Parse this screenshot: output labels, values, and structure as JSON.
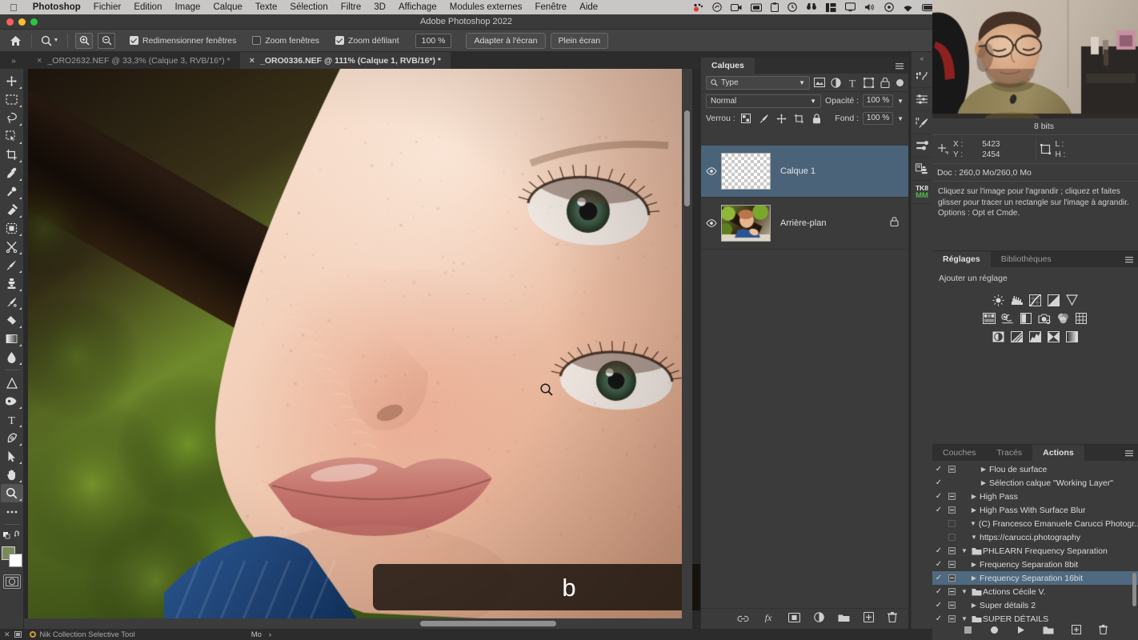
{
  "macmenu": {
    "apple": "",
    "items": [
      {
        "label": "Photoshop",
        "bold": true
      },
      {
        "label": "Fichier",
        "bold": false
      },
      {
        "label": "Edition",
        "bold": false
      },
      {
        "label": "Image",
        "bold": false
      },
      {
        "label": "Calque",
        "bold": false
      },
      {
        "label": "Texte",
        "bold": false
      },
      {
        "label": "Sélection",
        "bold": false
      },
      {
        "label": "Filtre",
        "bold": false
      },
      {
        "label": "3D",
        "bold": false
      },
      {
        "label": "Affichage",
        "bold": false
      },
      {
        "label": "Modules externes",
        "bold": false
      },
      {
        "label": "Fenêtre",
        "bold": false
      },
      {
        "label": "Aide",
        "bold": false
      }
    ],
    "tray_icons": [
      "record-icon",
      "creative-cloud-icon",
      "screen-record-icon",
      "display-icon",
      "clipboard-icon",
      "time-machine-icon",
      "binoculars-icon",
      "grid-icon",
      "monitor-icon",
      "volume-icon",
      "control-center-icon",
      "wifi-icon",
      "battery-icon"
    ]
  },
  "window": {
    "title": "Adobe Photoshop 2022"
  },
  "options_bar": {
    "home_icon": "home-icon",
    "tool_icon": "zoom-tool-icon",
    "zoom_in_label": "zoom-in-icon",
    "zoom_out_label": "zoom-out-icon",
    "checkboxes": [
      {
        "label": "Redimensionner fenêtres",
        "checked": true
      },
      {
        "label": "Zoom fenêtres",
        "checked": false
      },
      {
        "label": "Zoom défilant",
        "checked": true
      }
    ],
    "zoom_value": "100 %",
    "fit_screen": "Adapter à l'écran",
    "full_screen": "Plein écran"
  },
  "tabs": {
    "expander": "»",
    "items": [
      {
        "label": "_ORO2632.NEF @ 33,3% (Calque 3, RVB/16*) *",
        "active": false
      },
      {
        "label": "_ORO0336.NEF @ 111% (Calque 1, RVB/16*) *",
        "active": true
      }
    ]
  },
  "toolbar": {
    "tools": [
      {
        "name": "move-tool",
        "icon": "move"
      },
      {
        "name": "marquee-tool",
        "icon": "marquee"
      },
      {
        "name": "lasso-tool",
        "icon": "lasso"
      },
      {
        "name": "quick-selection-tool",
        "icon": "quickselect"
      },
      {
        "name": "crop-tool",
        "icon": "crop"
      },
      {
        "name": "eyedropper-tool",
        "icon": "eyedropper"
      },
      {
        "name": "spot-healing-brush-tool",
        "icon": "healing"
      },
      {
        "name": "patch-tool",
        "icon": "patch"
      },
      {
        "name": "frame-tool",
        "icon": "frame"
      },
      {
        "name": "scissors-tool",
        "icon": "scissors"
      },
      {
        "name": "brush-tool",
        "icon": "brush"
      },
      {
        "name": "clone-stamp-tool",
        "icon": "stamp"
      },
      {
        "name": "history-brush-tool",
        "icon": "historybrush"
      },
      {
        "name": "eraser-tool",
        "icon": "eraser"
      },
      {
        "name": "gradient-tool",
        "icon": "gradient"
      },
      {
        "name": "blur-tool",
        "icon": "blur"
      },
      {
        "name": "dodge-tool",
        "icon": "dodge"
      },
      {
        "name": "pen-tool",
        "icon": "penblob"
      },
      {
        "name": "type-tool",
        "icon": "type"
      },
      {
        "name": "path-tool",
        "icon": "path"
      },
      {
        "name": "path-selection-tool",
        "icon": "arrow"
      },
      {
        "name": "hand-tool",
        "icon": "hand"
      },
      {
        "name": "zoom-tool",
        "icon": "zoom",
        "selected": true
      },
      {
        "name": "more-tools",
        "icon": "ellipsis"
      }
    ],
    "foreground_color": "#7a8a5a",
    "background_color": "#ffffff"
  },
  "canvas": {
    "key_overlay": "b",
    "cursor": "zoom-cursor"
  },
  "layers_panel": {
    "tab_title": "Calques",
    "filter_label": "Type",
    "filter_icons": [
      "pixel-filter-icon",
      "adjustment-filter-icon",
      "type-filter-icon",
      "shape-filter-icon",
      "smartobject-filter-icon"
    ],
    "blend_mode": "Normal",
    "opacity_label": "Opacité :",
    "opacity_value": "100 %",
    "lock_label": "Verrou :",
    "lock_icons": [
      "lock-transparency-icon",
      "lock-image-icon",
      "lock-position-icon",
      "lock-artboard-icon",
      "lock-all-icon"
    ],
    "fill_label": "Fond :",
    "fill_value": "100 %",
    "layers": [
      {
        "name": "Calque 1",
        "visible": true,
        "selected": true,
        "thumb": "transparent",
        "locked": false
      },
      {
        "name": "Arrière-plan",
        "visible": true,
        "selected": false,
        "thumb": "photo",
        "locked": true
      }
    ],
    "footer_icons": [
      "link-layers-icon",
      "fx-icon",
      "add-mask-icon",
      "adjustment-layer-icon",
      "new-group-icon",
      "new-layer-icon",
      "delete-layer-icon"
    ]
  },
  "rail": {
    "collapse_icon": "collapse-panels-icon",
    "buttons": [
      "histogram-icon",
      "properties-icon",
      "brush-settings-icon",
      "sliders-icon",
      "clone-source-icon",
      "tk8-mm-icon"
    ],
    "tk_label_top": "TK8",
    "tk_label_bottom": "MM"
  },
  "info_panel": {
    "bits": "8 bits",
    "x_label": "X :",
    "y_label": "Y :",
    "x_value": "5423",
    "y_value": "2454",
    "w_label": "L :",
    "h_label": "H :",
    "w_value": "",
    "h_value": "",
    "doc": "Doc : 260,0 Mo/260,0 Mo",
    "hint": "Cliquez sur l'image pour l'agrandir ; cliquez et faites glisser pour tracer un rectangle sur l'image à agrandir. Options : Opt et Cmde."
  },
  "adjustments_panel": {
    "tabs": [
      {
        "label": "Réglages",
        "active": true
      },
      {
        "label": "Bibliothèques",
        "active": false
      }
    ],
    "add_label": "Ajouter un réglage",
    "rows": [
      [
        "brightness-contrast-icon",
        "levels-icon",
        "curves-icon",
        "exposure-icon",
        "vibrance-icon"
      ],
      [
        "hue-saturation-icon",
        "color-balance-icon",
        "black-white-icon",
        "photo-filter-icon",
        "channel-mixer-icon",
        "color-lookup-icon"
      ],
      [
        "invert-icon",
        "posterize-icon",
        "threshold-icon",
        "selective-color-icon",
        "gradient-map-icon"
      ]
    ]
  },
  "actions_panel": {
    "tabs": [
      {
        "label": "Couches",
        "active": false
      },
      {
        "label": "Tracés",
        "active": false
      },
      {
        "label": "Actions",
        "active": true
      }
    ],
    "rows": [
      {
        "label": "Flou de surface",
        "checked": true,
        "box": "minus",
        "arrow": "right",
        "indent": 2,
        "folder": false,
        "selected": false
      },
      {
        "label": "Sélection calque \"Working Layer\"",
        "checked": true,
        "box": "none",
        "arrow": "right",
        "indent": 2,
        "folder": false,
        "selected": false
      },
      {
        "label": "High Pass",
        "checked": true,
        "box": "minus",
        "arrow": "right",
        "indent": 1,
        "folder": false,
        "selected": false
      },
      {
        "label": "High Pass With Surface Blur",
        "checked": true,
        "box": "minus",
        "arrow": "right",
        "indent": 1,
        "folder": false,
        "selected": false
      },
      {
        "label": "(C) Francesco Emanuele Carucci Photogr...",
        "checked": false,
        "box": "empty",
        "arrow": "down",
        "indent": 1,
        "folder": false,
        "selected": false
      },
      {
        "label": "https://carucci.photography",
        "checked": false,
        "box": "empty",
        "arrow": "down",
        "indent": 1,
        "folder": false,
        "selected": false
      },
      {
        "label": "PHLEARN Frequency Separation",
        "checked": true,
        "box": "minus",
        "arrow": "down",
        "indent": 0,
        "folder": true,
        "selected": false
      },
      {
        "label": "Frequency Separation 8bit",
        "checked": true,
        "box": "minus",
        "arrow": "right",
        "indent": 1,
        "folder": false,
        "selected": false
      },
      {
        "label": "Frequency Separation 16bit",
        "checked": true,
        "box": "minus",
        "arrow": "right",
        "indent": 1,
        "folder": false,
        "selected": true
      },
      {
        "label": "Actions Cécile V.",
        "checked": true,
        "box": "minus",
        "arrow": "down",
        "indent": 0,
        "folder": true,
        "selected": false
      },
      {
        "label": "Super détails 2",
        "checked": true,
        "box": "minus",
        "arrow": "right",
        "indent": 1,
        "folder": false,
        "selected": false
      },
      {
        "label": "SUPER DÉTAILS",
        "checked": true,
        "box": "minus",
        "arrow": "down",
        "indent": 0,
        "folder": true,
        "selected": false
      }
    ],
    "footer_icons": [
      "stop-icon",
      "record-icon",
      "play-icon",
      "new-set-icon",
      "new-action-icon",
      "delete-icon"
    ]
  },
  "status_bar": {
    "close_icon": "close-icon",
    "panel_icon": "panel-icon",
    "plugin_name": "Nik Collection Selective Tool",
    "unit": "Mo",
    "chevron": "›"
  },
  "colors": {
    "panel_bg": "#3b3b3b",
    "panel_dark": "#2c2c2c",
    "selection_blue": "#4a6378",
    "action_selection": "#4f6a80",
    "text": "#d6d6d6",
    "menubar": "#c8c7c5"
  }
}
